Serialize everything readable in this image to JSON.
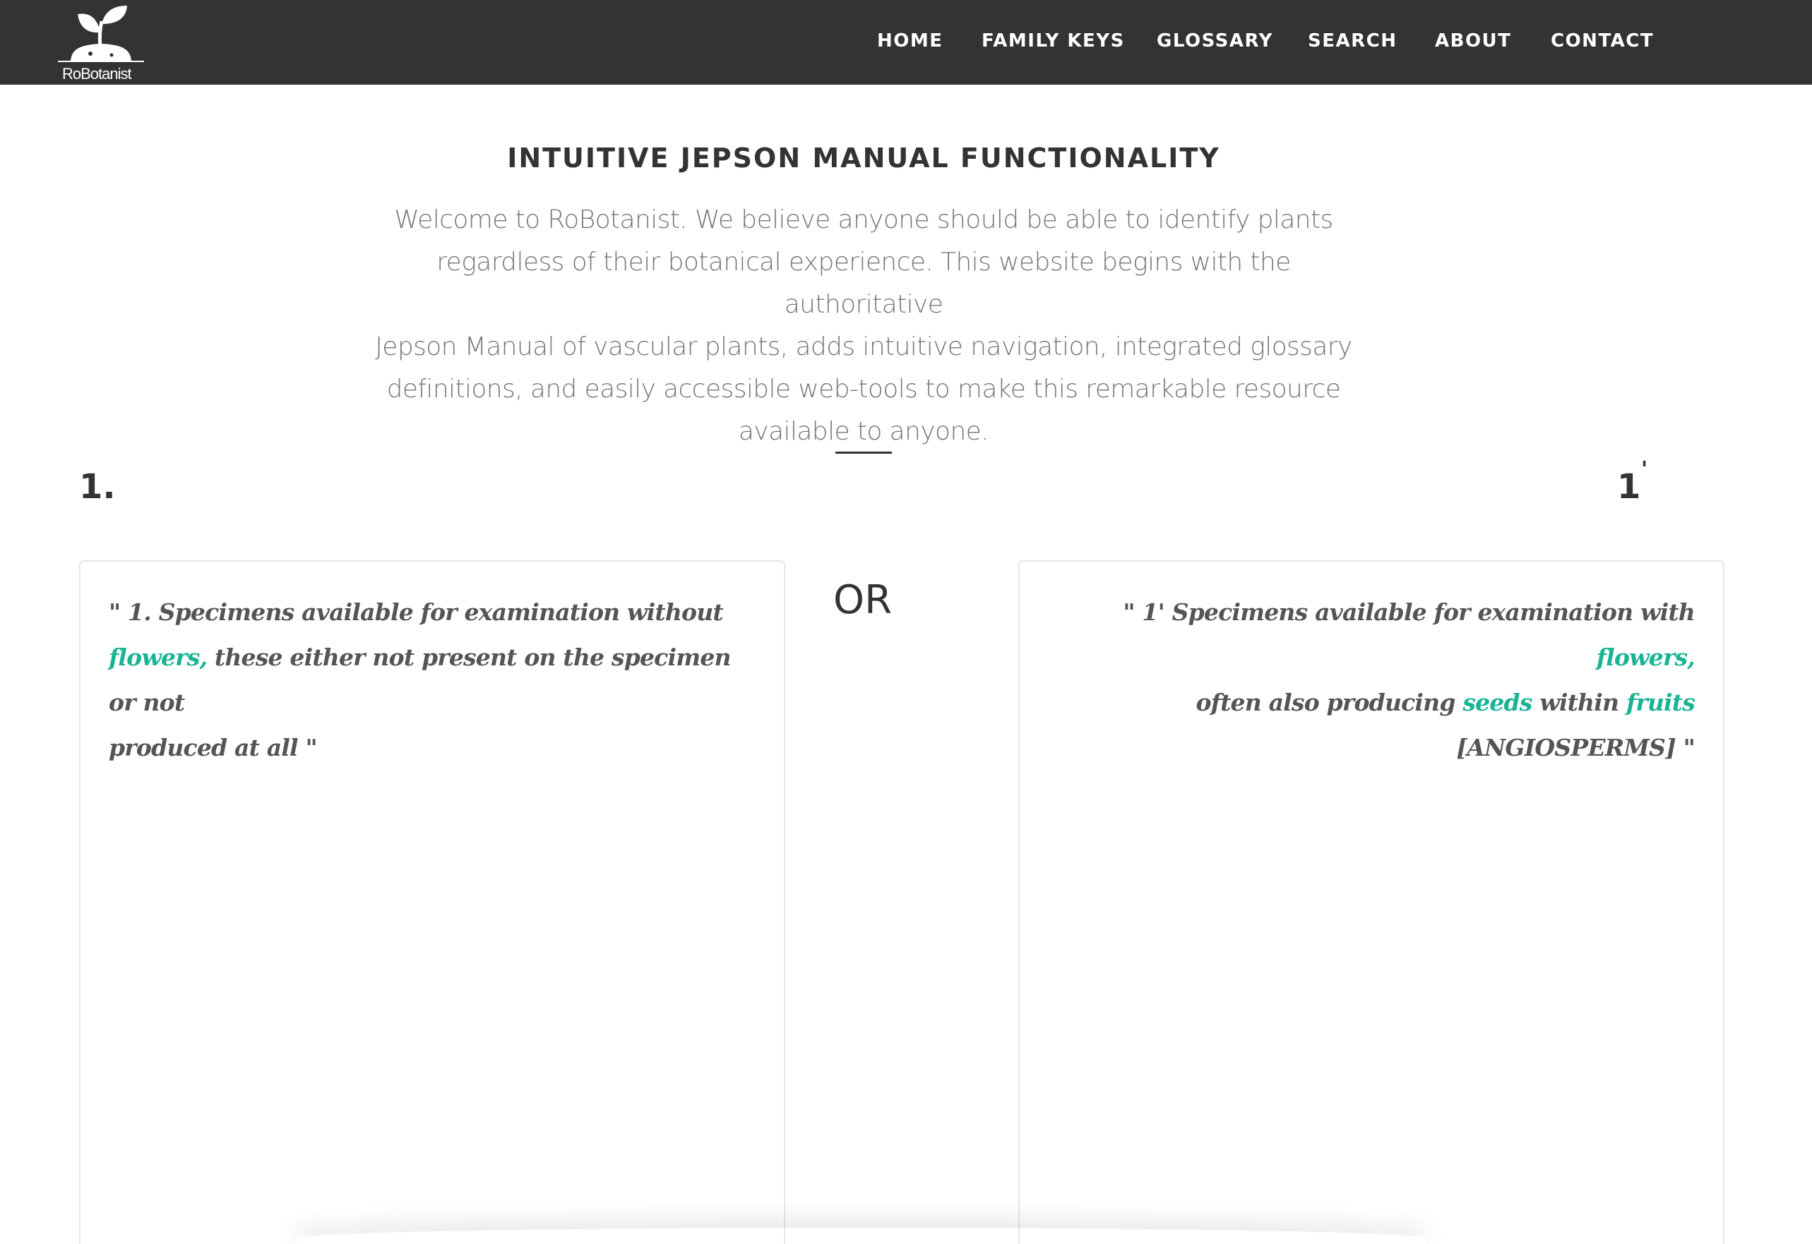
{
  "nav": {
    "logo_text": "RoBotanist",
    "items": [
      {
        "label": "HOME"
      },
      {
        "label": "FAMILY KEYS"
      },
      {
        "label": "GLOSSARY"
      },
      {
        "label": "SEARCH"
      },
      {
        "label": "ABOUT"
      },
      {
        "label": "CONTACT"
      }
    ]
  },
  "header": {
    "title": "INTUITIVE JEPSON MANUAL FUNCTIONALITY",
    "intro_lines": [
      "Welcome to RoBotanist. We believe anyone should be able to identify plants",
      "regardless of their botanical experience. This website begins with the authoritative",
      "Jepson Manual of vascular plants, adds intuitive navigation, integrated glossary",
      "definitions, and easily accessible web-tools to make this remarkable resource",
      "available to anyone."
    ]
  },
  "couplet": {
    "left_label": "1.",
    "right_label": "1",
    "right_prime": "'",
    "or_label": "OR",
    "left": {
      "line1": "\" 1. Specimens available for examination without",
      "gloss1": "flowers,",
      "line2_rest": " these either not present on the specimen or not",
      "line3": "produced at all \""
    },
    "right": {
      "line1_start": "\" 1' Specimens available for examination with ",
      "gloss1": "flowers,",
      "line2_start": "often also producing ",
      "gloss2": "seeds",
      "line2_mid": " within ",
      "gloss3": "fruits",
      "line3": "[ANGIOSPERMS] \""
    }
  },
  "colors": {
    "navbar_bg": "#333333",
    "glossary_link": "#18b495",
    "body_text": "#777777"
  }
}
